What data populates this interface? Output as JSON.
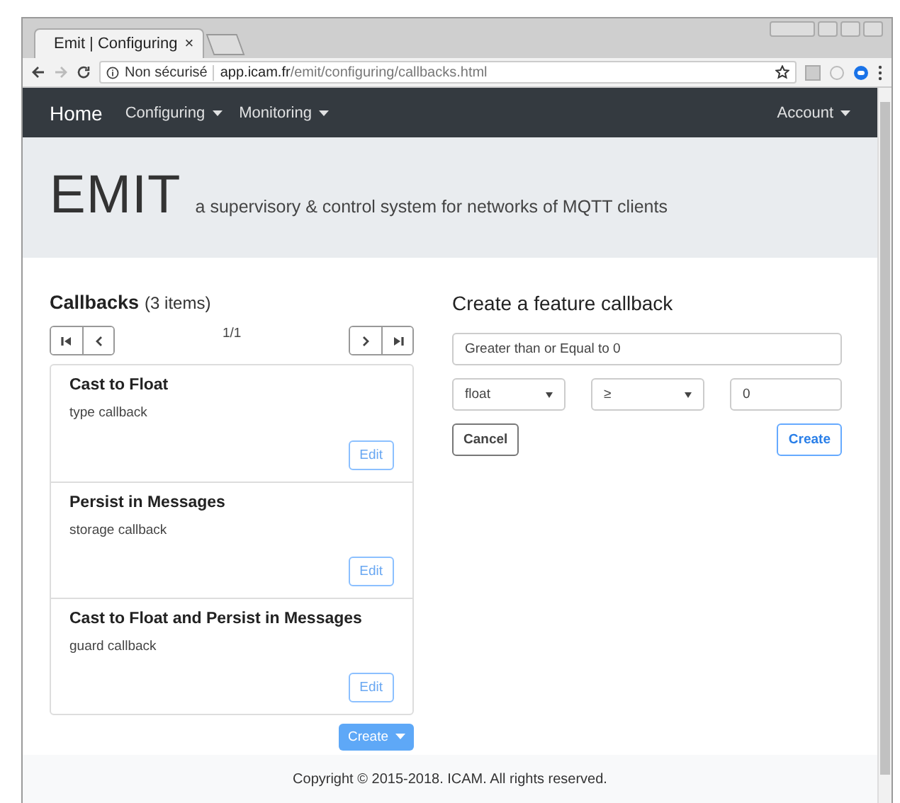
{
  "browser": {
    "tab_title": "Emit | Configuring",
    "tab_close": "×",
    "security": "Non sécurisé",
    "url_host": "app.icam.fr",
    "url_path": "/emit/configuring/callbacks.html"
  },
  "navbar": {
    "brand": "Home",
    "items": [
      {
        "label": "Configuring",
        "dropdown": true
      },
      {
        "label": "Monitoring",
        "dropdown": true
      }
    ],
    "account": {
      "label": "Account",
      "dropdown": true
    }
  },
  "jumbotron": {
    "title": "EMIT",
    "lead": "a supervisory & control system for networks of MQTT clients"
  },
  "callbacks": {
    "title": "Callbacks",
    "count": "(3 items)",
    "page": "1/1",
    "items": [
      {
        "name": "Cast to Float",
        "type": "type callback",
        "action": "Edit"
      },
      {
        "name": "Persist in Messages",
        "type": "storage callback",
        "action": "Edit"
      },
      {
        "name": "Cast to Float and Persist in Messages",
        "type": "guard callback",
        "action": "Edit"
      }
    ],
    "create": {
      "label": "Create",
      "dropdown": true
    }
  },
  "form": {
    "title": "Create a feature callback",
    "name": "Greater than or Equal to 0",
    "type": "float",
    "operator": "≥",
    "value": "0",
    "cancel": "Cancel",
    "submit": "Create"
  },
  "footer": "Copyright © 2015-2018. ICAM. All rights reserved."
}
